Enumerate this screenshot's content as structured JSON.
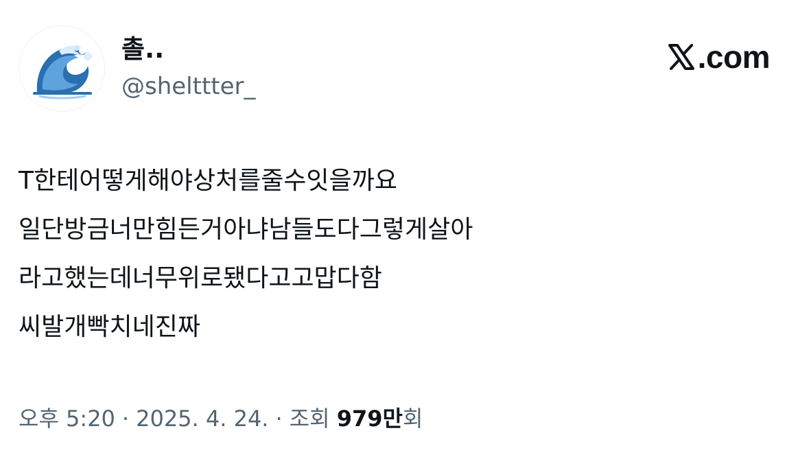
{
  "author": {
    "display_name": "촐..",
    "handle": "@shelttter_",
    "avatar_icon": "water-wave-icon"
  },
  "brand": {
    "text": ".com",
    "icon": "x-logo-icon"
  },
  "tweet": {
    "lines": [
      "T한테어떻게해야상처를줄수잇을까요",
      "일단방금너만힘든거아냐남들도다그렇게살아",
      "라고했는데너무위로됐다고고맙다함",
      "씨발개빡치네진짜"
    ]
  },
  "meta": {
    "time": "오후 5:20",
    "separator": "·",
    "date": "2025. 4. 24.",
    "views_label": "조회",
    "views_count": "979만",
    "views_suffix": "회"
  },
  "colors": {
    "text": "#0f1419",
    "secondary": "#536471",
    "wave_dark": "#2a6fb0",
    "wave_light": "#9fd1f5"
  }
}
